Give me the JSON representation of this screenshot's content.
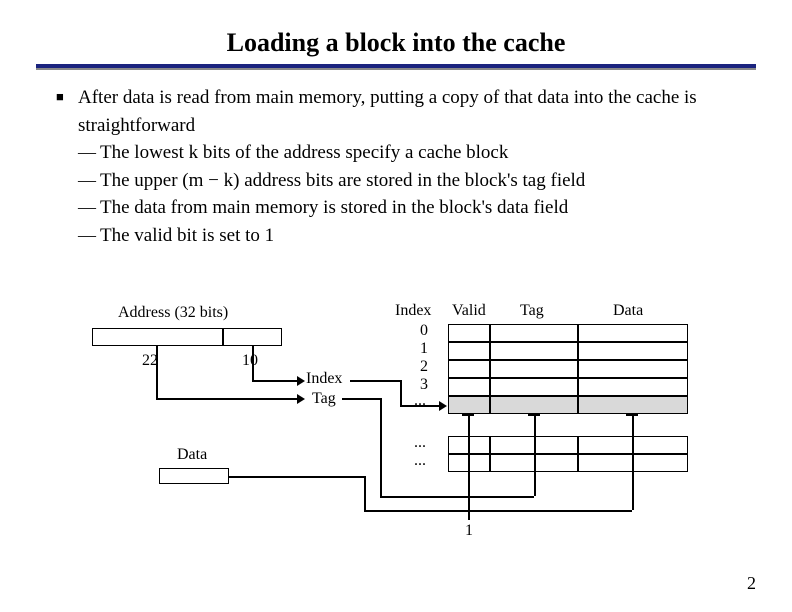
{
  "title": "Loading a block into the cache",
  "bullets": {
    "main": "After data is read from main memory, putting a copy of that data into the cache is straightforward",
    "sub1": "The lowest k bits of the address specify a cache block",
    "sub2": "The upper (m − k) address bits are stored in the block's tag field",
    "sub3": "The data from main memory is stored in the block's data field",
    "sub4": "The valid bit is set to 1"
  },
  "diagram": {
    "address_label": "Address (32 bits)",
    "tag_bits": "22",
    "index_bits": "10",
    "index_label": "Index",
    "tag_label": "Tag",
    "data_label": "Data",
    "table": {
      "col_index": "Index",
      "col_valid": "Valid",
      "col_tag": "Tag",
      "col_data": "Data",
      "rows": [
        "0",
        "1",
        "2",
        "3",
        "...",
        "...",
        "..."
      ]
    },
    "one": "1"
  },
  "page": "2"
}
